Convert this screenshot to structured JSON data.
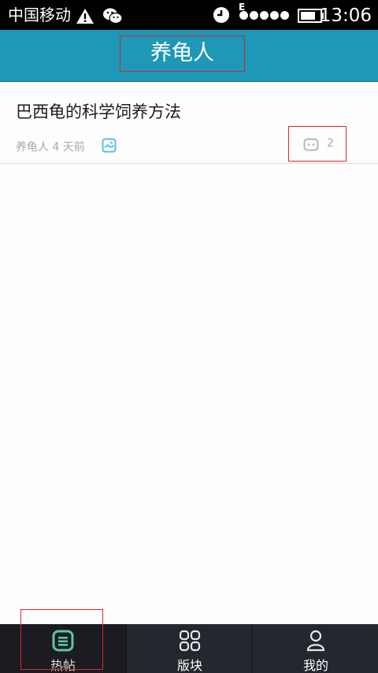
{
  "status_bar": {
    "carrier": "中国移动",
    "network_type": "E",
    "time": "13:06",
    "icons": [
      "warning-icon",
      "wechat-icon",
      "alarm-clock-icon",
      "signal-icon",
      "battery-icon"
    ]
  },
  "header": {
    "title": "养龟人"
  },
  "posts": [
    {
      "title": "巴西龟的科学饲养方法",
      "author": "养龟人",
      "time_ago": "4 天前",
      "has_image_icon": "image-icon",
      "comment_count": "2"
    }
  ],
  "bottom_nav": {
    "tabs": [
      {
        "label": "热帖",
        "icon": "hot-posts-icon",
        "active": true
      },
      {
        "label": "版块",
        "icon": "grid-icon",
        "active": false
      },
      {
        "label": "我的",
        "icon": "profile-icon",
        "active": false
      }
    ]
  },
  "colors": {
    "header_bg": "#1f97b6",
    "nav_bg": "#24272e",
    "active_icon": "#5bc89f",
    "highlight_box": "#d9262b"
  }
}
